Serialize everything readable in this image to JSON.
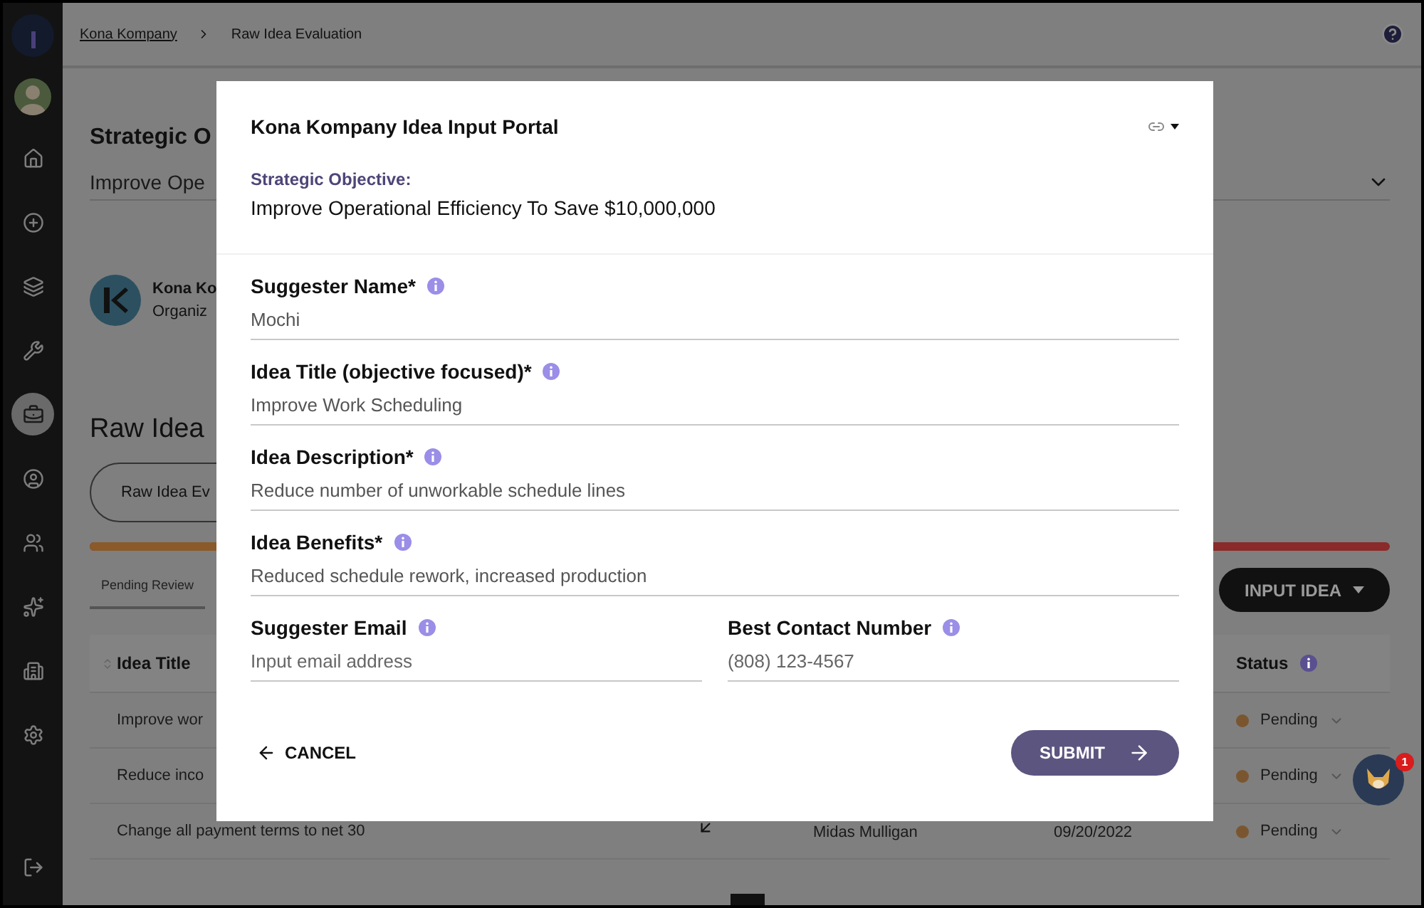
{
  "sidebar": {
    "items": [
      {
        "selected": false
      },
      {
        "selected": false
      },
      {
        "selected": false
      },
      {
        "selected": false
      },
      {
        "selected": true
      },
      {
        "selected": false
      },
      {
        "selected": false
      },
      {
        "selected": false
      },
      {
        "selected": false
      },
      {
        "selected": false
      },
      {
        "selected": false
      }
    ]
  },
  "breadcrumb": [
    "Kona Kompany",
    "Raw Idea Evaluation"
  ],
  "page": {
    "heading": "Strategic O",
    "objective": "Improve Ope",
    "organization": {
      "name": "Kona Ko",
      "role": "Organiz"
    },
    "section_title": "Raw Idea",
    "filter_button": "Raw Idea Ev",
    "progress": {
      "level": 0.4
    },
    "tabs": [
      {
        "label": "Pending Review",
        "selected": true
      }
    ],
    "input_button": "INPUT IDEA",
    "table": {
      "columns": [
        "Idea Title",
        "Status"
      ],
      "rows": [
        {
          "title": "Improve wor",
          "status": "Pending"
        },
        {
          "title": "Reduce inco",
          "status": "Pending"
        },
        {
          "title": "Change all payment terms to net 30",
          "suggester": "Midas Mulligan",
          "date": "09/20/2022",
          "status": "Pending"
        }
      ]
    }
  },
  "modal": {
    "title": "Kona Kompany Idea Input Portal",
    "objective_label": "Strategic Objective:",
    "objective": "Improve Operational Efficiency To Save $10,000,000",
    "fields": [
      {
        "label": "Suggester Name*",
        "value": "Mochi"
      },
      {
        "label": "Idea Title (objective focused)*",
        "value": "Improve Work Scheduling"
      },
      {
        "label": "Idea Description*",
        "value": "Reduce number of unworkable schedule lines"
      },
      {
        "label": "Idea Benefits*",
        "value": "Reduced schedule rework, increased production"
      }
    ],
    "contact_fields": [
      {
        "label": "Suggester Email",
        "placeholder": "Input email address"
      },
      {
        "label": "Best Contact Number",
        "placeholder": "(808) 123-4567"
      }
    ],
    "cancel": "CANCEL",
    "submit": "SUBMIT"
  },
  "chat": {
    "badge": "1"
  }
}
